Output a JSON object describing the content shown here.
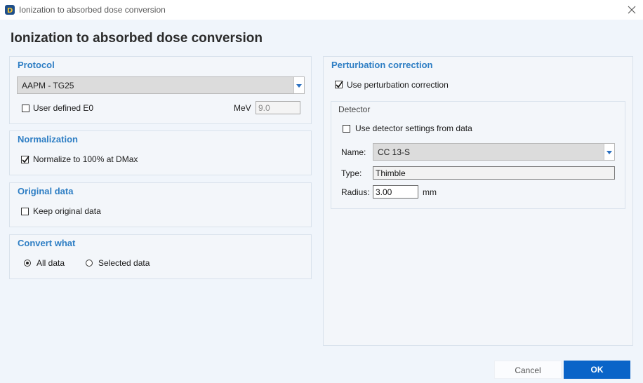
{
  "window": {
    "title": "Ionization to absorbed dose conversion"
  },
  "page_title": "Ionization to absorbed dose conversion",
  "protocol": {
    "title": "Protocol",
    "selected": "AAPM - TG25",
    "user_defined_label": "User defined E0",
    "user_defined_checked": false,
    "unit_label": "MeV",
    "energy_value": "9.0"
  },
  "normalization": {
    "title": "Normalization",
    "checkbox_label": "Normalize to 100% at DMax",
    "checked": true
  },
  "original_data": {
    "title": "Original data",
    "checkbox_label": "Keep original data",
    "checked": false
  },
  "convert_what": {
    "title": "Convert what",
    "options": [
      "All data",
      "Selected data"
    ],
    "selected": "All data"
  },
  "perturbation": {
    "title": "Perturbation correction",
    "checkbox_label": "Use perturbation correction",
    "checked": true,
    "detector": {
      "title": "Detector",
      "use_settings_label": "Use detector settings from data",
      "use_settings_checked": false,
      "name_label": "Name:",
      "name_value": "CC 13-S",
      "type_label": "Type:",
      "type_value": "Thimble",
      "radius_label": "Radius:",
      "radius_value": "3.00",
      "radius_unit": "mm"
    }
  },
  "buttons": {
    "cancel": "Cancel",
    "ok": "OK"
  },
  "colors": {
    "accent": "#2e7ec4",
    "primary_button": "#0a64c8",
    "background": "#f0f5fb"
  }
}
